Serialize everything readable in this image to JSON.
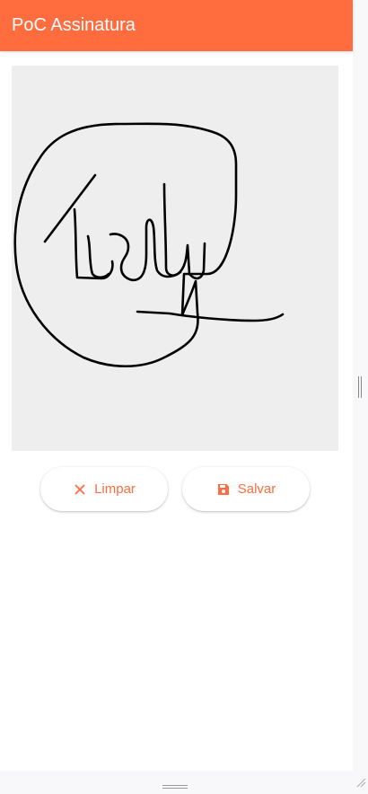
{
  "app": {
    "title": "PoC Assinatura",
    "accent_color": "#ff6d3f"
  },
  "signature_pad": {
    "background_color": "#eeeeee",
    "stroke_color": "#000000"
  },
  "actions": {
    "clear_label": "Limpar",
    "clear_icon": "close-icon",
    "save_label": "Salvar",
    "save_icon": "floppy-disk-icon"
  }
}
